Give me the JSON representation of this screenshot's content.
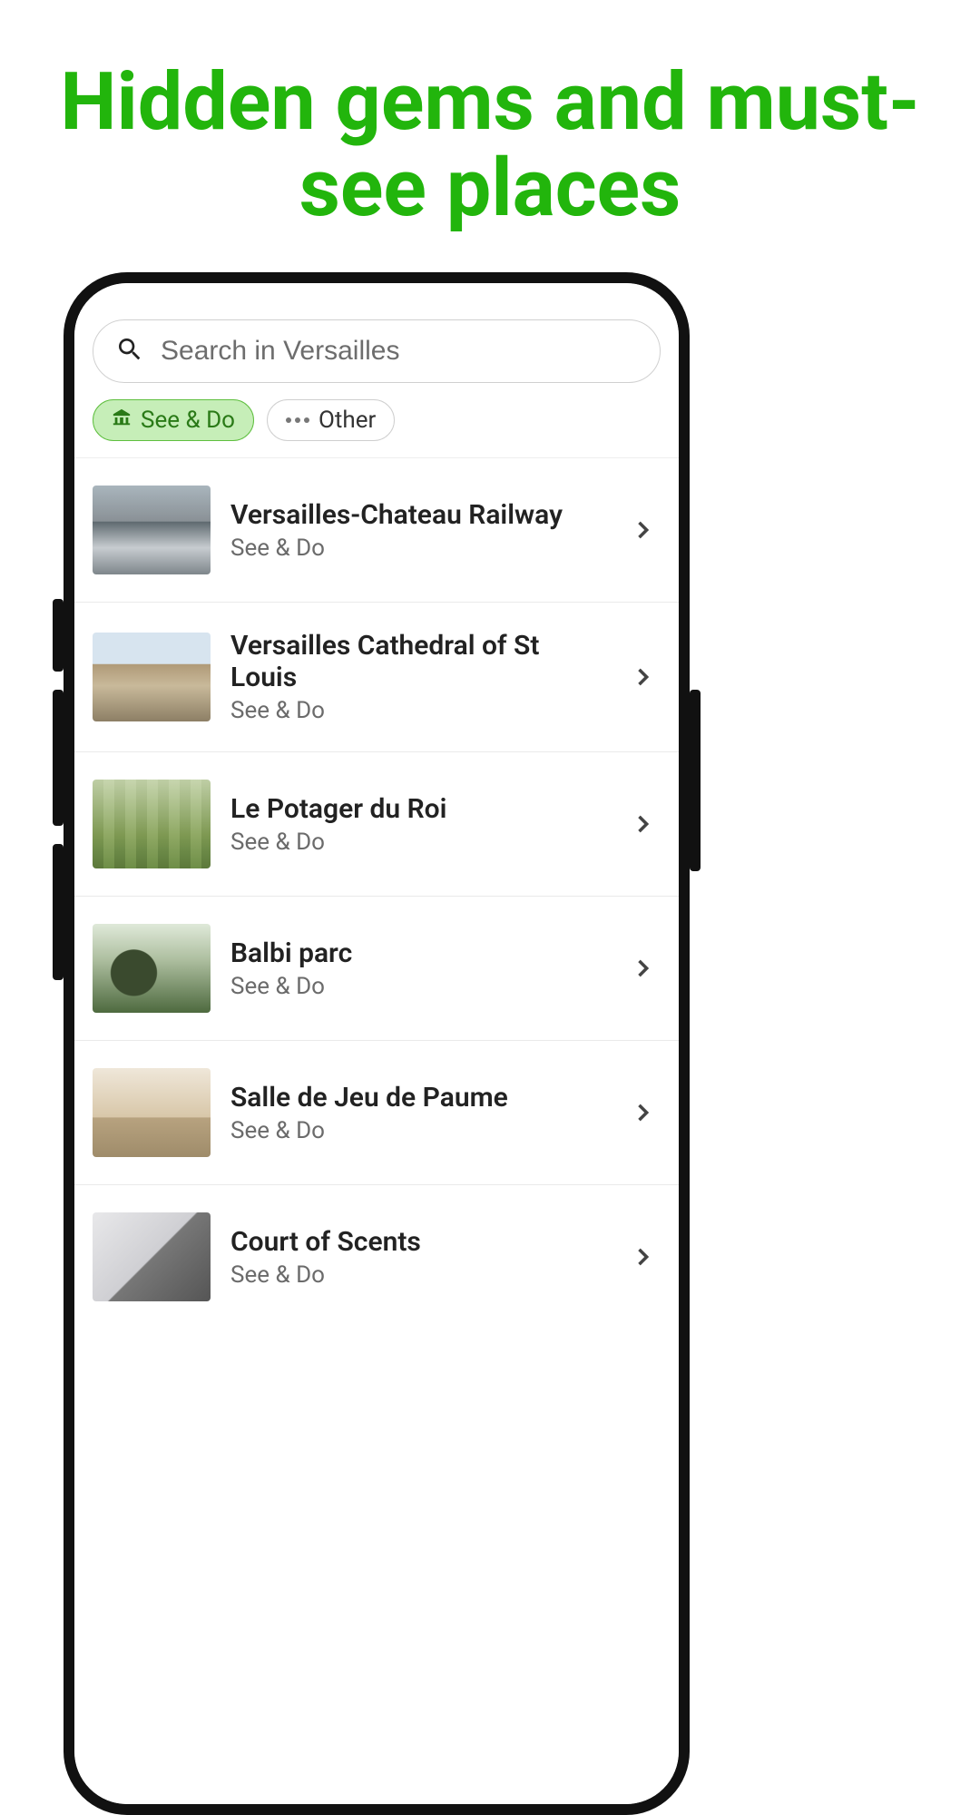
{
  "headline": "Hidden gems and must-see places",
  "search": {
    "placeholder": "Search in Versailles"
  },
  "filters": {
    "see_do": "See & Do",
    "other": "Other"
  },
  "places": [
    {
      "title": "Versailles-Chateau Railway",
      "category": "See & Do"
    },
    {
      "title": "Versailles Cathedral of St Louis",
      "category": "See & Do"
    },
    {
      "title": "Le Potager du Roi",
      "category": "See & Do"
    },
    {
      "title": "Balbi parc",
      "category": "See & Do"
    },
    {
      "title": "Salle de Jeu de Paume",
      "category": "See & Do"
    },
    {
      "title": "Court of Scents",
      "category": "See & Do"
    }
  ]
}
